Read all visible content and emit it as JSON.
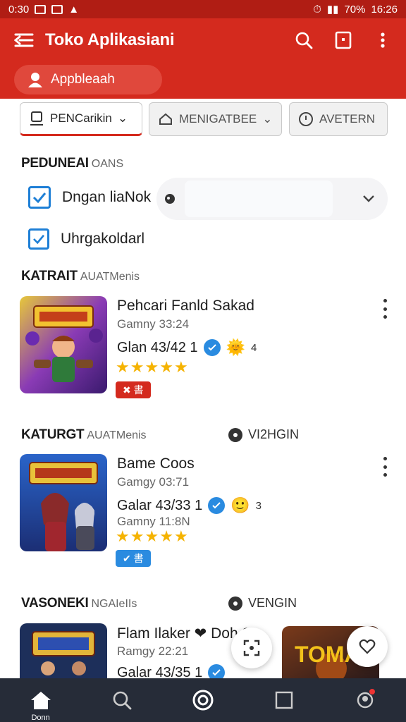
{
  "status_bar": {
    "time_left": "0:30",
    "battery": "70%",
    "time_right": "16:26"
  },
  "app_bar": {
    "title": "Toko Aplikasiani",
    "account_label": "Appbleaah"
  },
  "filters": [
    {
      "label": "PENCarikin"
    },
    {
      "label": "MENIGATBEE"
    },
    {
      "label": "AVETERN"
    }
  ],
  "preferences": {
    "title": "PEDUNEAI",
    "subtitle": "OANS",
    "options": [
      {
        "label": "Dngan liaNok",
        "checked": true
      },
      {
        "label": "Uhrgakoldarl",
        "checked": true
      }
    ]
  },
  "sections": [
    {
      "title": "KATRAIT",
      "subtitle": "AUATMenis",
      "right_label": "",
      "app": {
        "title": "Pehcari Fanld Sakad",
        "subtitle": "Gamny 33:24",
        "rating": "Glan 43/42 1",
        "reaction_count": "4",
        "stars": 5,
        "badge": "✖ 書",
        "badge_color": "#d42a1e"
      }
    },
    {
      "title": "KATURGT",
      "subtitle": "AUATMenis",
      "right_label": "VI2HGIN",
      "app": {
        "title": "Bame Coos",
        "subtitle": "Gamgy 03:71",
        "rating": "Galar 43/33 1",
        "subtitle2": "Gamny 11:8N",
        "reaction_count": "3",
        "stars": 5,
        "badge": "✔ 書",
        "badge_color": "#2a8be0"
      }
    },
    {
      "title": "VASONEKI",
      "subtitle": "NGAIeIIs",
      "right_label": "VENGIN",
      "app": {
        "title": "Flam Ilaker ❤ Doh 9",
        "subtitle": "Ramgy 22:21",
        "rating": "Galar 43/35 1"
      },
      "side_thumb_text": "TOMA"
    }
  ],
  "nav": {
    "home_label": "Donn"
  },
  "colors": {
    "primary": "#d42a1e",
    "accent_blue": "#2a8be0",
    "star": "#f5b301",
    "nav_bg": "#262c38"
  }
}
